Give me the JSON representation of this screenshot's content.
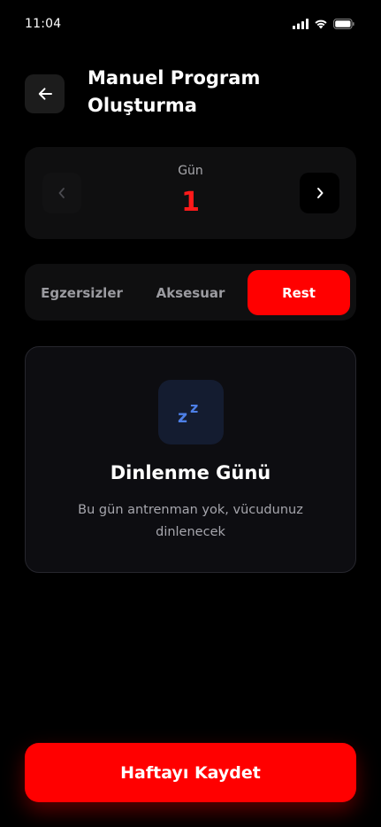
{
  "status_bar": {
    "time": "11:04",
    "icons": [
      "signal-icon",
      "wifi-icon",
      "battery-icon"
    ]
  },
  "header": {
    "back_icon": "arrow-left-icon",
    "title": "Manuel Program Oluşturma"
  },
  "day_selector": {
    "label": "Gün",
    "value": "1",
    "prev_icon": "chevron-left-icon",
    "next_icon": "chevron-right-icon"
  },
  "tabs": [
    {
      "label": "Egzersizler",
      "active": false
    },
    {
      "label": "Aksesuar",
      "active": false
    },
    {
      "label": "Rest",
      "active": true
    }
  ],
  "rest_card": {
    "icon": "sleep-zz-icon",
    "icon_text_1": "z",
    "icon_text_2": "z",
    "title": "Dinlenme Günü",
    "description": "Bu gün antrenman yok, vücudunuz dinlenecek"
  },
  "save_button": {
    "label": "Haftayı Kaydet"
  },
  "colors": {
    "accent": "#ff0000",
    "background": "#000000",
    "card": "#0f0f10",
    "rest_icon": "#4d7fe6"
  }
}
